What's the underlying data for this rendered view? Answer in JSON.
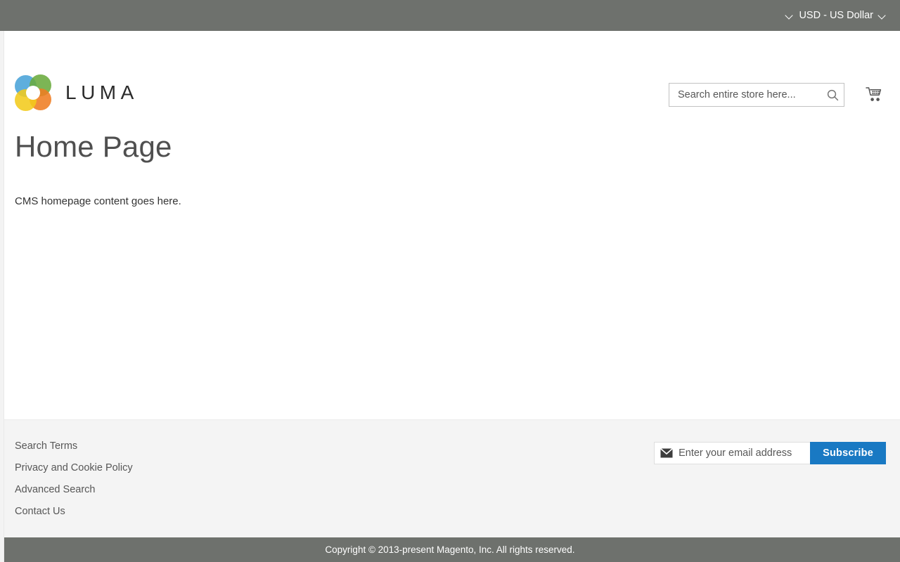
{
  "top_panel": {
    "currency_switcher": {
      "label": "USD - US Dollar",
      "left_icon": "chevron-down-icon",
      "right_icon": "chevron-down-icon"
    }
  },
  "header": {
    "logo": {
      "text": "LUMA",
      "mark_colors": {
        "blue": "#49a3d8",
        "green": "#6aab3e",
        "orange": "#ef7d22",
        "yellow": "#f2cb1d"
      }
    },
    "search": {
      "placeholder": "Search entire store here...",
      "value": "",
      "icon": "search-icon"
    },
    "cart": {
      "icon": "shopping-cart-icon"
    }
  },
  "main": {
    "page_title": "Home Page",
    "cms_content": "CMS homepage content goes here."
  },
  "footer": {
    "links": [
      {
        "label": "Search Terms"
      },
      {
        "label": "Privacy and Cookie Policy"
      },
      {
        "label": "Advanced Search"
      },
      {
        "label": "Contact Us"
      }
    ],
    "newsletter": {
      "icon": "envelope-icon",
      "placeholder": "Enter your email address",
      "value": "",
      "subscribe_label": "Subscribe",
      "button_color": "#1979c3"
    }
  },
  "copyright": {
    "text": "Copyright © 2013-present Magento, Inc. All rights reserved.",
    "background": "#6e716d"
  }
}
